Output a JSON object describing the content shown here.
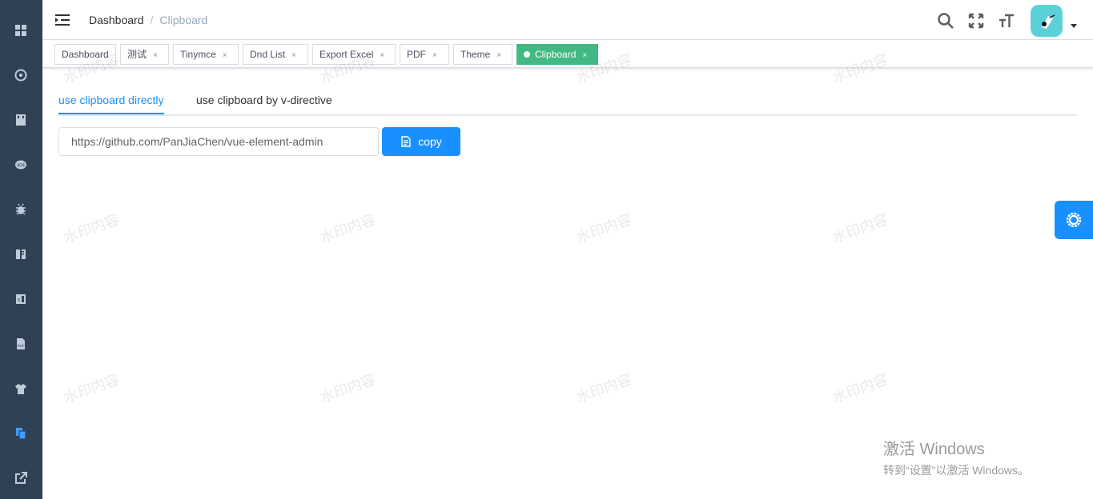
{
  "sidebar": {
    "items": [
      {
        "icon": "dashboard-icon",
        "active": false
      },
      {
        "icon": "guide-icon",
        "active": false
      },
      {
        "icon": "table-icon",
        "active": false
      },
      {
        "icon": "error-page-404-icon",
        "active": false
      },
      {
        "icon": "bug-icon",
        "active": false
      },
      {
        "icon": "zip-icon",
        "active": false
      },
      {
        "icon": "excel-icon",
        "active": false
      },
      {
        "icon": "pdf-icon",
        "active": false
      },
      {
        "icon": "theme-shirt-icon",
        "active": false
      },
      {
        "icon": "clipboard-icon",
        "active": true
      },
      {
        "icon": "external-link-icon",
        "active": false
      }
    ],
    "background": "#304156",
    "icon_color": "#bfcbd9",
    "active_color": "#409eff"
  },
  "navbar": {
    "breadcrumb": {
      "first": "Dashboard",
      "separator": "/",
      "current": "Clipboard"
    },
    "icons": [
      "search-icon",
      "fullscreen-icon",
      "text-size-icon"
    ]
  },
  "tags": [
    {
      "label": "Dashboard",
      "closable": false,
      "active": false
    },
    {
      "label": "测试",
      "closable": true,
      "active": false
    },
    {
      "label": "Tinymce",
      "closable": true,
      "active": false
    },
    {
      "label": "Dnd List",
      "closable": true,
      "active": false
    },
    {
      "label": "Export Excel",
      "closable": true,
      "active": false
    },
    {
      "label": "PDF",
      "closable": true,
      "active": false
    },
    {
      "label": "Theme",
      "closable": true,
      "active": false
    },
    {
      "label": "Clipboard",
      "closable": true,
      "active": true
    }
  ],
  "tag_close": "×",
  "tabs": [
    {
      "label": "use clipboard directly",
      "active": true
    },
    {
      "label": "use clipboard by v-directive",
      "active": false
    }
  ],
  "clipboard": {
    "input_value": "https://github.com/PanJiaChen/vue-element-admin",
    "copy_label": "copy"
  },
  "watermark": "水印内容",
  "windows_activation": {
    "title": "激活 Windows",
    "subtitle": "转到“设置”以激活 Windows。"
  },
  "colors": {
    "primary": "#1890ff",
    "tag_active": "#42b983",
    "breadcrumb_current": "#97a8be"
  }
}
